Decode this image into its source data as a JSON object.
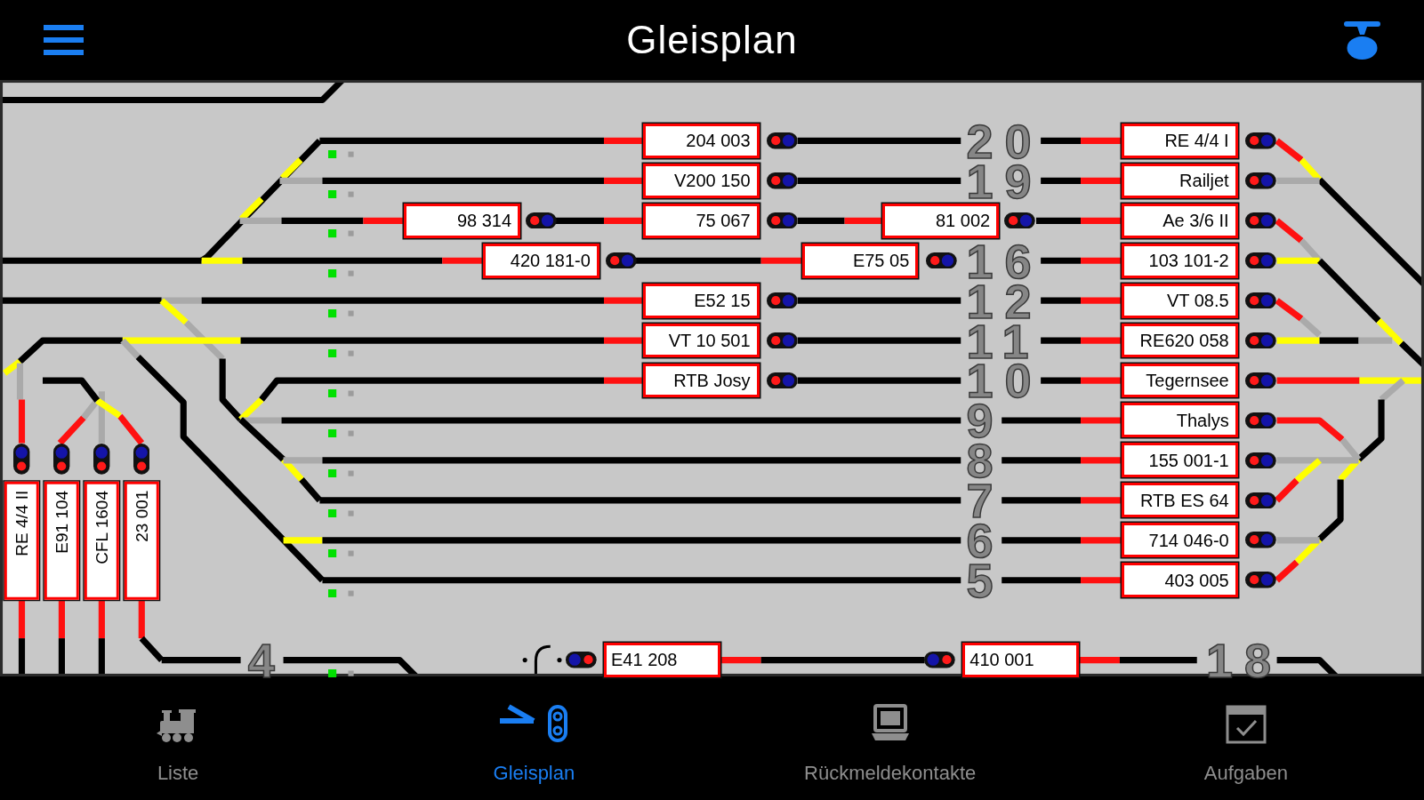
{
  "nav_bar": {
    "title": "Gleisplan"
  },
  "track_plan": {
    "track_numbers": [
      {
        "label": "20"
      },
      {
        "label": "19"
      },
      {
        "label": "16"
      },
      {
        "label": "12"
      },
      {
        "label": "11"
      },
      {
        "label": "10"
      },
      {
        "label": "9"
      },
      {
        "label": "8"
      },
      {
        "label": "7"
      },
      {
        "label": "6"
      },
      {
        "label": "5"
      },
      {
        "label": "4"
      },
      {
        "label": "18"
      }
    ],
    "trains": [
      {
        "label": "204 003"
      },
      {
        "label": "RE 4/4 I"
      },
      {
        "label": "V200 150"
      },
      {
        "label": "Railjet"
      },
      {
        "label": "98 314"
      },
      {
        "label": "75 067"
      },
      {
        "label": "81 002"
      },
      {
        "label": "Ae 3/6 II"
      },
      {
        "label": "420 181-0"
      },
      {
        "label": "E75 05"
      },
      {
        "label": "103 101-2"
      },
      {
        "label": "E52 15"
      },
      {
        "label": "VT 08.5"
      },
      {
        "label": "VT 10 501"
      },
      {
        "label": "RE620 058"
      },
      {
        "label": "RTB Josy"
      },
      {
        "label": "Tegernsee"
      },
      {
        "label": "Thalys"
      },
      {
        "label": "155 001-1"
      },
      {
        "label": "RTB ES 64"
      },
      {
        "label": "714 046-0"
      },
      {
        "label": "403 005"
      },
      {
        "label": "E41 208"
      },
      {
        "label": "410 001"
      }
    ],
    "siding_trains": [
      {
        "label": "RE 4/4 II"
      },
      {
        "label": "E91 104"
      },
      {
        "label": "CFL 1604"
      },
      {
        "label": "23 001"
      }
    ]
  },
  "tab_bar": {
    "tabs": [
      {
        "label": "Liste",
        "selected": false
      },
      {
        "label": "Gleisplan",
        "selected": true
      },
      {
        "label": "Rückmeldekontakte",
        "selected": false
      },
      {
        "label": "Aufgaben",
        "selected": false
      }
    ]
  }
}
